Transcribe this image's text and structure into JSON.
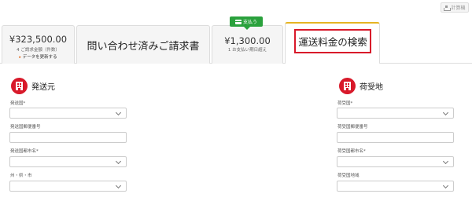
{
  "toolbar": {
    "calculate_label": "計算機"
  },
  "tabs": {
    "invoice_summary": {
      "amount": "¥323,500.00",
      "sub": "4 ご請求金額（件数）",
      "link": "データを更新する"
    },
    "inquired_invoices": {
      "title": "問い合わせ済みご請求書"
    },
    "payment": {
      "badge": "支払う",
      "amount": "¥1,300.00",
      "sub": "1 お支払い期日超え"
    },
    "shipping_search": {
      "title": "運送料金の検索"
    }
  },
  "origin": {
    "title": "発送元",
    "fields": [
      {
        "label": "発送国*",
        "type": "select",
        "value": ""
      },
      {
        "label": "発送国郵便番号",
        "type": "text",
        "value": ""
      },
      {
        "label": "発送国都市名*",
        "type": "select",
        "value": ""
      },
      {
        "label": "州・県・市",
        "type": "select",
        "value": ""
      }
    ]
  },
  "destination": {
    "title": "荷受地",
    "fields": [
      {
        "label": "荷受国*",
        "type": "select",
        "value": ""
      },
      {
        "label": "荷受国郵便番号",
        "type": "text",
        "value": ""
      },
      {
        "label": "荷受国都市名*",
        "type": "select",
        "value": ""
      },
      {
        "label": "荷受国地域",
        "type": "select",
        "value": ""
      }
    ]
  },
  "colors": {
    "accent": "#d8192a",
    "pay_green": "#2aa13c",
    "active_tab_border": "#e6b422"
  }
}
